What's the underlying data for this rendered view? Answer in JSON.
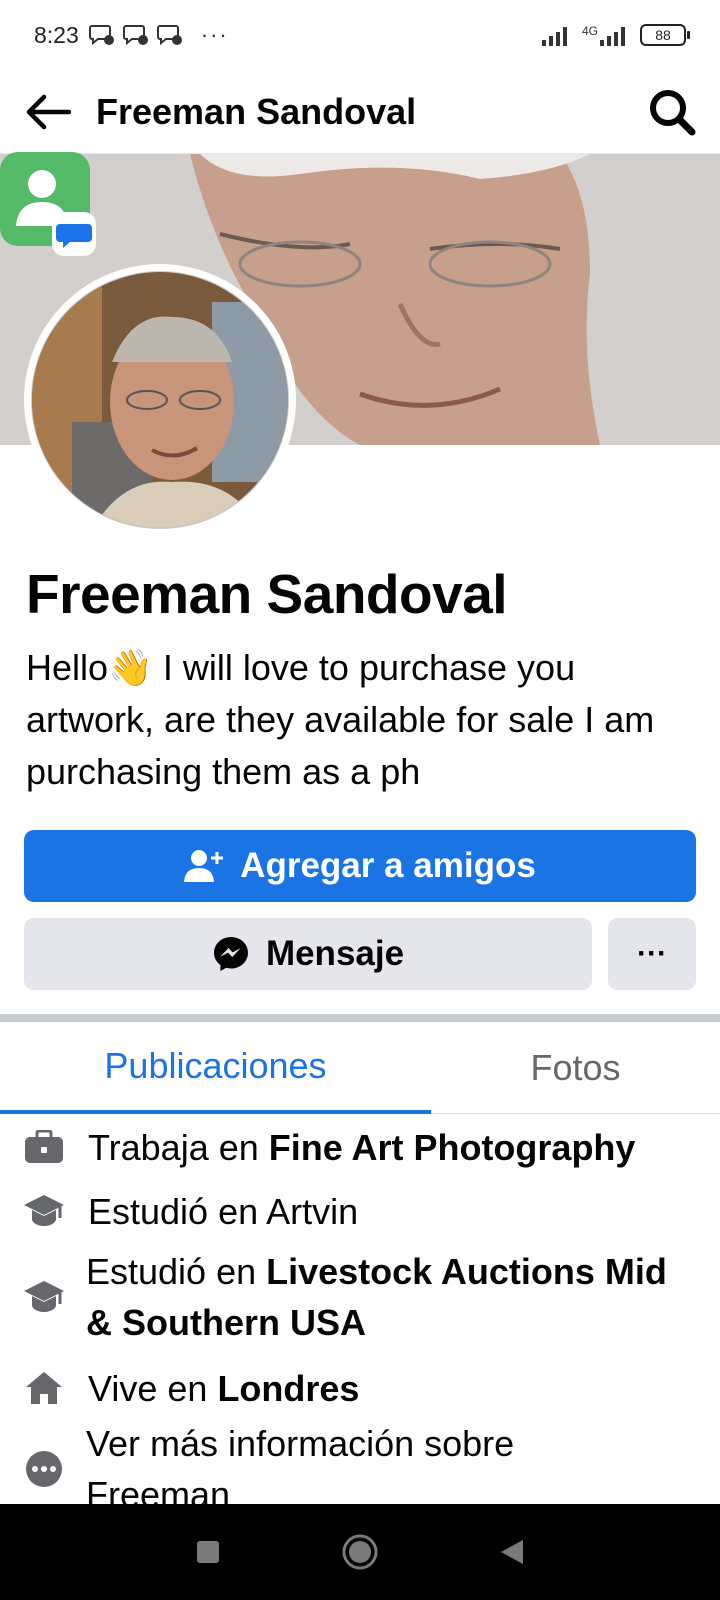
{
  "status_bar": {
    "time": "8:23",
    "dots": "···",
    "network": "4G",
    "battery": "88"
  },
  "app_bar": {
    "title": "Freeman Sandoval"
  },
  "profile": {
    "name": "Freeman Sandoval",
    "bio_prefix": "Hello",
    "bio_emoji": "👋",
    "bio_rest": " I will love to purchase you artwork, are they available for sale I am purchasing them as a ph"
  },
  "actions": {
    "add_friend_label": "Agregar a amigos",
    "message_label": "Mensaje",
    "more_label": "···"
  },
  "tabs": [
    {
      "label": "Publicaciones",
      "active": true
    },
    {
      "label": "Fotos",
      "active": false
    }
  ],
  "intro": {
    "work_prefix": "Trabaja en ",
    "work_place": "Fine Art Photography",
    "study1_text": "Estudió en Artvin",
    "study2_prefix": "Estudió en ",
    "study2_place": "Livestock Auctions Mid & Southern USA",
    "lives_prefix": "Vive en ",
    "lives_place": "Londres",
    "more_info": "Ver más información sobre Freeman"
  },
  "colors": {
    "accent": "#1b74e4",
    "button_gray": "#e4e6eb",
    "icon_gray": "#65676b"
  }
}
